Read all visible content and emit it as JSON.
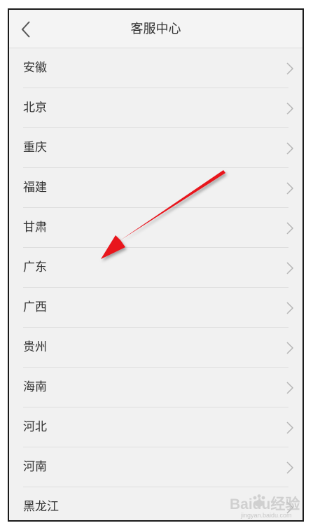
{
  "header": {
    "title": "客服中心"
  },
  "regions": [
    {
      "label": "安徽"
    },
    {
      "label": "北京"
    },
    {
      "label": "重庆"
    },
    {
      "label": "福建"
    },
    {
      "label": "甘肃"
    },
    {
      "label": "广东"
    },
    {
      "label": "广西"
    },
    {
      "label": "贵州"
    },
    {
      "label": "海南"
    },
    {
      "label": "河北"
    },
    {
      "label": "河南"
    },
    {
      "label": "黑龙江"
    }
  ],
  "annotation": {
    "color": "#e8121b"
  },
  "watermark": {
    "brand": "Baidu经验",
    "sub": "jingyan.baidu.com"
  }
}
